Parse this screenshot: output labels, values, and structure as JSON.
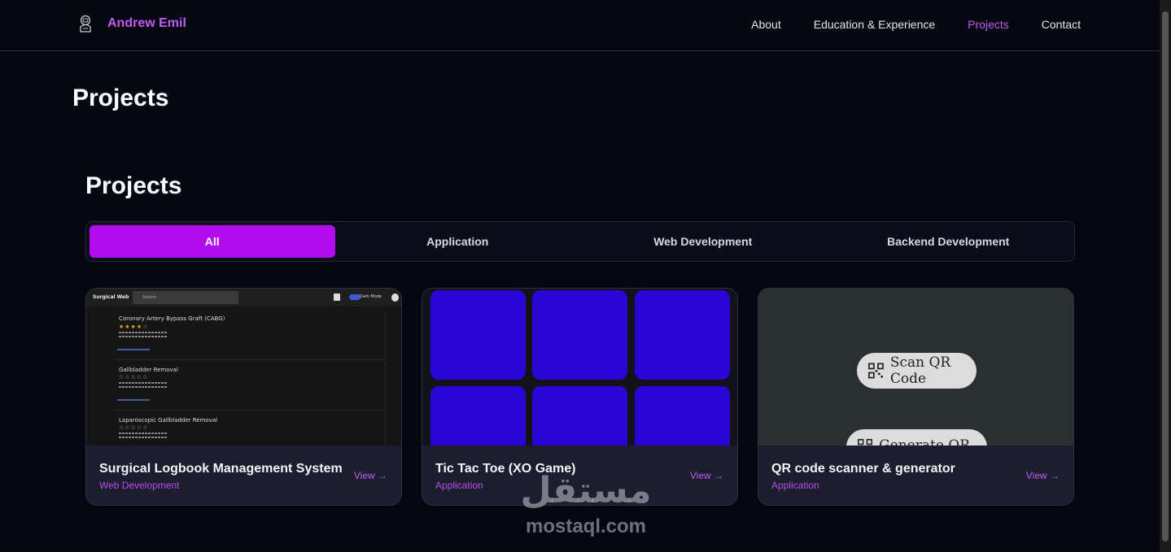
{
  "nav": {
    "brand": "Andrew Emil",
    "links": [
      {
        "label": "About"
      },
      {
        "label": "Education & Experience"
      },
      {
        "label": "Projects"
      },
      {
        "label": "Contact"
      }
    ],
    "active": "Projects"
  },
  "page_title": "Projects",
  "section_title": "Projects",
  "filters": [
    "All",
    "Application",
    "Web Development",
    "Backend Development"
  ],
  "active_filter": "All",
  "projects": [
    {
      "title": "Surgical Logbook Management System",
      "category": "Web Development",
      "view_label": "View →",
      "preview": {
        "brand": "Surgical Web",
        "search_placeholder": "Search",
        "mode_label": "Dark Mode",
        "items": [
          {
            "name": "Coronary Artery Bypass Graft (CABG)",
            "stars": "★★★★☆"
          },
          {
            "name": "Gallbladder Removal",
            "stars": "☆☆☆☆☆"
          },
          {
            "name": "Laparoscopic Gallbladder Removal",
            "stars": "☆☆☆☆☆"
          }
        ]
      }
    },
    {
      "title": "Tic Tac Toe (XO Game)",
      "category": "Application",
      "view_label": "View →"
    },
    {
      "title": "QR code scanner & generator",
      "category": "Application",
      "view_label": "View →",
      "preview": {
        "scan_label": "Scan QR Code",
        "generate_label": "Generate QR Code"
      }
    }
  ],
  "watermark": {
    "arabic": "مستقل",
    "latin": "mostaql.com"
  },
  "colors": {
    "accent": "#c15bf0",
    "active_tab": "#b10cf0",
    "background": "#040612",
    "ttt_cell": "#2a06d6"
  }
}
